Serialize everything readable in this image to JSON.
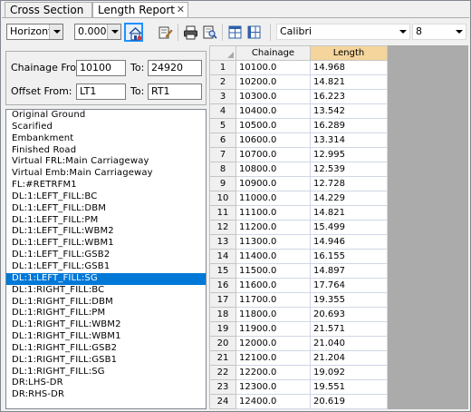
{
  "tabs": [
    {
      "label": "Cross Section"
    },
    {
      "label": "Length Report",
      "close": "✕"
    }
  ],
  "toolbar": {
    "orientation_value": "Horizont",
    "offset_value": "0.000",
    "font_value": "Calibri",
    "font_size_value": "8"
  },
  "offset": {
    "chainage_from_label": "Chainage From",
    "chainage_from_value": "10100",
    "to_label": "To:",
    "chainage_to_value": "24920",
    "offset_from_label": "Offset From:",
    "offset_from_value": "LT1",
    "offset_to_label": "To:",
    "offset_to_value": "RT1"
  },
  "layers": [
    "Original Ground",
    "Scarified",
    "Embankment",
    "Finished Road",
    "Virtual FRL:Main Carriageway",
    "Virtual Emb:Main Carriageway",
    "FL:#RETRFM1",
    "DL:1:LEFT_FILL:BC",
    "DL:1:LEFT_FILL:DBM",
    "DL:1:LEFT_FILL:PM",
    "DL:1:LEFT_FILL:WBM2",
    "DL:1:LEFT_FILL:WBM1",
    "DL:1:LEFT_FILL:GSB2",
    "DL:1:LEFT_FILL:GSB1",
    "DL:1:LEFT_FILL:SG",
    "DL:1:RIGHT_FILL:BC",
    "DL:1:RIGHT_FILL:DBM",
    "DL:1:RIGHT_FILL:PM",
    "DL:1:RIGHT_FILL:WBM2",
    "DL:1:RIGHT_FILL:WBM1",
    "DL:1:RIGHT_FILL:GSB2",
    "DL:1:RIGHT_FILL:GSB1",
    "DL:1:RIGHT_FILL:SG",
    "DR:LHS-DR",
    "DR:RHS-DR"
  ],
  "selected_layer_index": 14,
  "grid": {
    "headers": [
      "Chainage",
      "Length"
    ],
    "rows": [
      [
        "1",
        "10100.0",
        "14.968"
      ],
      [
        "2",
        "10200.0",
        "14.821"
      ],
      [
        "3",
        "10300.0",
        "16.223"
      ],
      [
        "4",
        "10400.0",
        "13.542"
      ],
      [
        "5",
        "10500.0",
        "16.289"
      ],
      [
        "6",
        "10600.0",
        "13.314"
      ],
      [
        "7",
        "10700.0",
        "12.995"
      ],
      [
        "8",
        "10800.0",
        "12.539"
      ],
      [
        "9",
        "10900.0",
        "12.728"
      ],
      [
        "10",
        "11000.0",
        "14.229"
      ],
      [
        "11",
        "11100.0",
        "14.821"
      ],
      [
        "12",
        "11200.0",
        "15.499"
      ],
      [
        "13",
        "11300.0",
        "14.946"
      ],
      [
        "14",
        "11400.0",
        "16.155"
      ],
      [
        "15",
        "11500.0",
        "14.897"
      ],
      [
        "16",
        "11600.0",
        "17.764"
      ],
      [
        "17",
        "11700.0",
        "19.355"
      ],
      [
        "18",
        "11800.0",
        "20.693"
      ],
      [
        "19",
        "11900.0",
        "21.571"
      ],
      [
        "20",
        "12000.0",
        "21.040"
      ],
      [
        "21",
        "12100.0",
        "21.204"
      ],
      [
        "22",
        "12200.0",
        "19.092"
      ],
      [
        "23",
        "12300.0",
        "19.551"
      ],
      [
        "24",
        "12400.0",
        "20.619"
      ]
    ]
  },
  "icons": {
    "home_report": "house-report-icon",
    "edit": "edit-note-icon",
    "print": "printer-icon",
    "print_preview": "print-preview-icon",
    "col_layout": "column-layout-icon",
    "row_layout": "row-layout-icon"
  },
  "colors": {
    "selection": "#0078d7",
    "highlight_header": "#f5d59c",
    "toolbar_selected_border": "#1e90ff"
  }
}
